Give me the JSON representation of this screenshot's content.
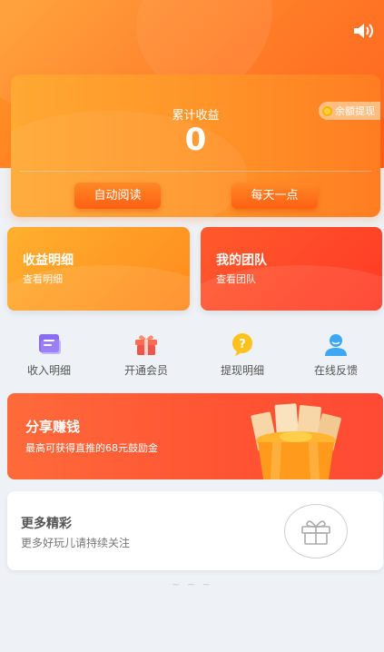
{
  "header": {
    "sound_icon": "speaker-icon"
  },
  "earnings": {
    "label": "累计收益",
    "value": "0",
    "withdraw_label": "余额提现",
    "auto_read_label": "自动阅读",
    "daily_label": "每天一点"
  },
  "cards": {
    "income": {
      "title": "收益明细",
      "sub": "查看明细"
    },
    "team": {
      "title": "我的团队",
      "sub": "查看团队"
    }
  },
  "quick": [
    {
      "label": "收入明细",
      "icon": "document-icon",
      "color": "#8a6cf2"
    },
    {
      "label": "开通会员",
      "icon": "gift-icon",
      "color": "#f0544a"
    },
    {
      "label": "提现明细",
      "icon": "question-icon",
      "color": "#ffc21c"
    },
    {
      "label": "在线反馈",
      "icon": "user-icon",
      "color": "#3ca7f5"
    }
  ],
  "share": {
    "title": "分享赚钱",
    "sub": "最高可获得直推的68元鼓励金"
  },
  "more": {
    "title": "更多精彩",
    "sub": "更多好玩儿请持续关注"
  },
  "footer": {
    "loading": "~ ~ ~"
  },
  "colors": {
    "orange": "#ff8a1e",
    "red": "#ff4a34",
    "background": "#eef1f5"
  }
}
